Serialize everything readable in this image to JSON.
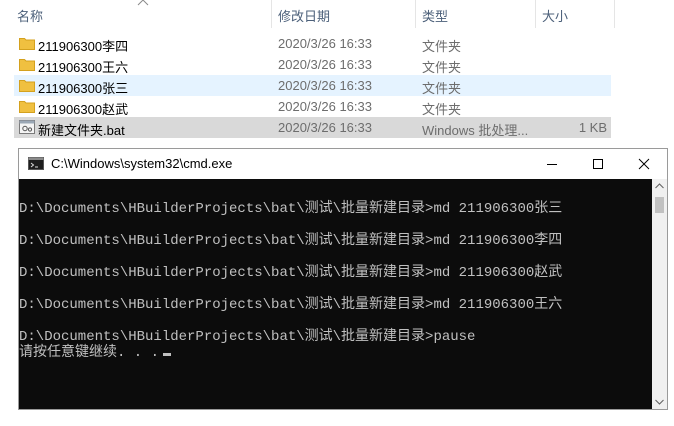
{
  "explorer": {
    "columns": {
      "name": "名称",
      "date": "修改日期",
      "type": "类型",
      "size": "大小"
    },
    "rows": [
      {
        "name": "211906300李四",
        "date": "2020/3/26 16:33",
        "type": "文件夹",
        "size": "",
        "icon": "folder-icon"
      },
      {
        "name": "211906300王六",
        "date": "2020/3/26 16:33",
        "type": "文件夹",
        "size": "",
        "icon": "folder-icon"
      },
      {
        "name": "211906300张三",
        "date": "2020/3/26 16:33",
        "type": "文件夹",
        "size": "",
        "icon": "folder-icon"
      },
      {
        "name": "211906300赵武",
        "date": "2020/3/26 16:33",
        "type": "文件夹",
        "size": "",
        "icon": "folder-icon"
      },
      {
        "name": "新建文件夹.bat",
        "date": "2020/3/26 16:33",
        "type": "Windows 批处理...",
        "size": "1 KB",
        "icon": "batch-file-icon"
      }
    ]
  },
  "cmd": {
    "title": "C:\\Windows\\system32\\cmd.exe",
    "lines": [
      "D:\\Documents\\HBuilderProjects\\bat\\测试\\批量新建目录>md 211906300张三",
      "D:\\Documents\\HBuilderProjects\\bat\\测试\\批量新建目录>md 211906300李四",
      "D:\\Documents\\HBuilderProjects\\bat\\测试\\批量新建目录>md 211906300赵武",
      "D:\\Documents\\HBuilderProjects\\bat\\测试\\批量新建目录>md 211906300王六",
      "D:\\Documents\\HBuilderProjects\\bat\\测试\\批量新建目录>pause",
      "请按任意键继续. . ."
    ]
  },
  "colors": {
    "folder": "#f0c040",
    "selection": "#e5f3ff",
    "console_bg": "#0c0c0c",
    "console_text": "#c0c0c0"
  }
}
